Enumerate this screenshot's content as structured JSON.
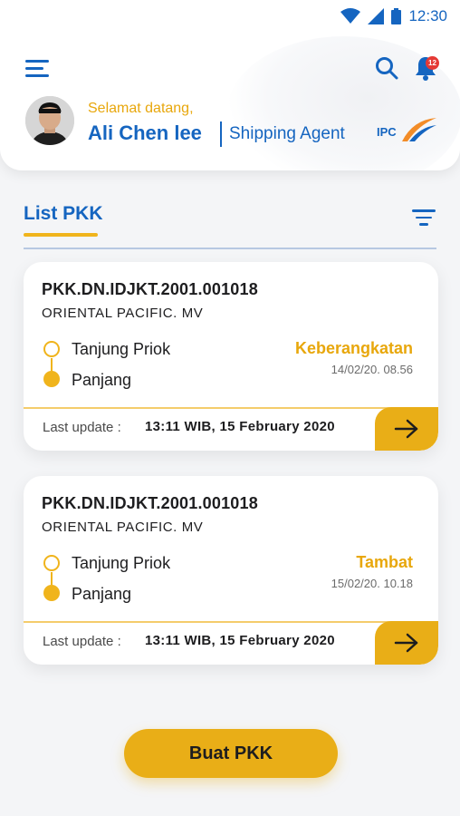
{
  "status_bar": {
    "time": "12:30",
    "icons": [
      "wifi-icon",
      "signal-icon",
      "battery-icon"
    ]
  },
  "header": {
    "menu_icon": "menu-icon",
    "search_icon": "search-icon",
    "notification_icon": "bell-icon",
    "notification_count": "12",
    "greeting": "Selamat datang,",
    "user_name": "Ali Chen lee",
    "user_role": "Shipping Agent",
    "logo_text": "IPC"
  },
  "tab": {
    "label": "List PKK",
    "filter_icon": "filter-icon"
  },
  "cards": [
    {
      "pkk_id": "PKK.DN.IDJKT.2001.001018",
      "vessel": "ORIENTAL PACIFIC. MV",
      "origin": "Tanjung Priok",
      "destination": "Panjang",
      "status": "Keberangkatan",
      "status_time": "14/02/20. 08.56",
      "last_update_label": "Last update :",
      "last_update_value": "13:11 WIB, 15 February 2020"
    },
    {
      "pkk_id": "PKK.DN.IDJKT.2001.001018",
      "vessel": "ORIENTAL PACIFIC. MV",
      "origin": "Tanjung Priok",
      "destination": "Panjang",
      "status": "Tambat",
      "status_time": "15/02/20. 10.18",
      "last_update_label": "Last update :",
      "last_update_value": "13:11 WIB, 15 February 2020"
    }
  ],
  "cta": {
    "label": "Buat PKK"
  },
  "colors": {
    "primary_blue": "#1565c0",
    "accent_yellow": "#e9ae17",
    "notification_red": "#e53935"
  }
}
